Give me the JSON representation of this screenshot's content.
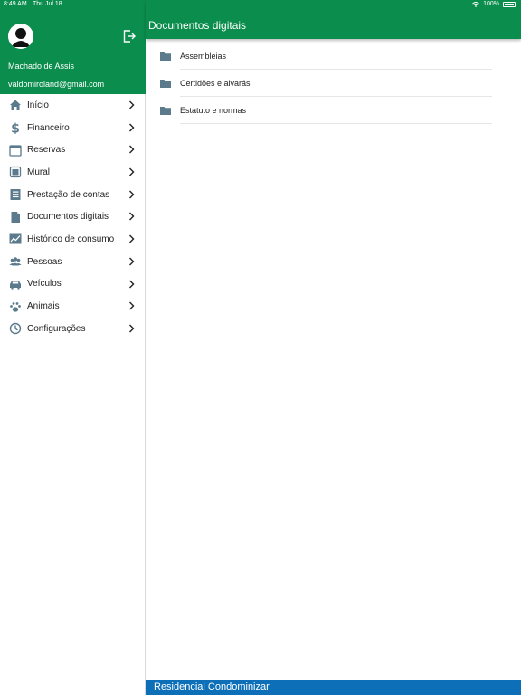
{
  "status_bar": {
    "time": "8:49 AM",
    "date": "Thu Jul 18",
    "battery": "100%"
  },
  "profile": {
    "name": "Machado de Assis",
    "email": "valdomiroland@gmail.com"
  },
  "menu": [
    {
      "label": "Início",
      "icon": "home-icon"
    },
    {
      "label": "Financeiro",
      "icon": "dollar-icon"
    },
    {
      "label": "Reservas",
      "icon": "calendar-icon"
    },
    {
      "label": "Mural",
      "icon": "board-icon"
    },
    {
      "label": "Prestação de contas",
      "icon": "ledger-icon"
    },
    {
      "label": "Documentos digitais",
      "icon": "document-icon"
    },
    {
      "label": "Histórico de consumo",
      "icon": "chart-icon"
    },
    {
      "label": "Pessoas",
      "icon": "people-icon"
    },
    {
      "label": "Veículos",
      "icon": "car-icon"
    },
    {
      "label": "Animais",
      "icon": "paw-icon"
    },
    {
      "label": "Configurações",
      "icon": "settings-icon"
    }
  ],
  "header": {
    "title": "Documentos digitais"
  },
  "folders": [
    {
      "label": "Assembleias"
    },
    {
      "label": "Certidões e alvarás"
    },
    {
      "label": "Estatuto e normas"
    }
  ],
  "footer": {
    "text": "Residencial Condominizar"
  },
  "colors": {
    "primary": "#0b8d4d",
    "footer": "#0d6fb8",
    "icon": "#5b7a8c"
  }
}
